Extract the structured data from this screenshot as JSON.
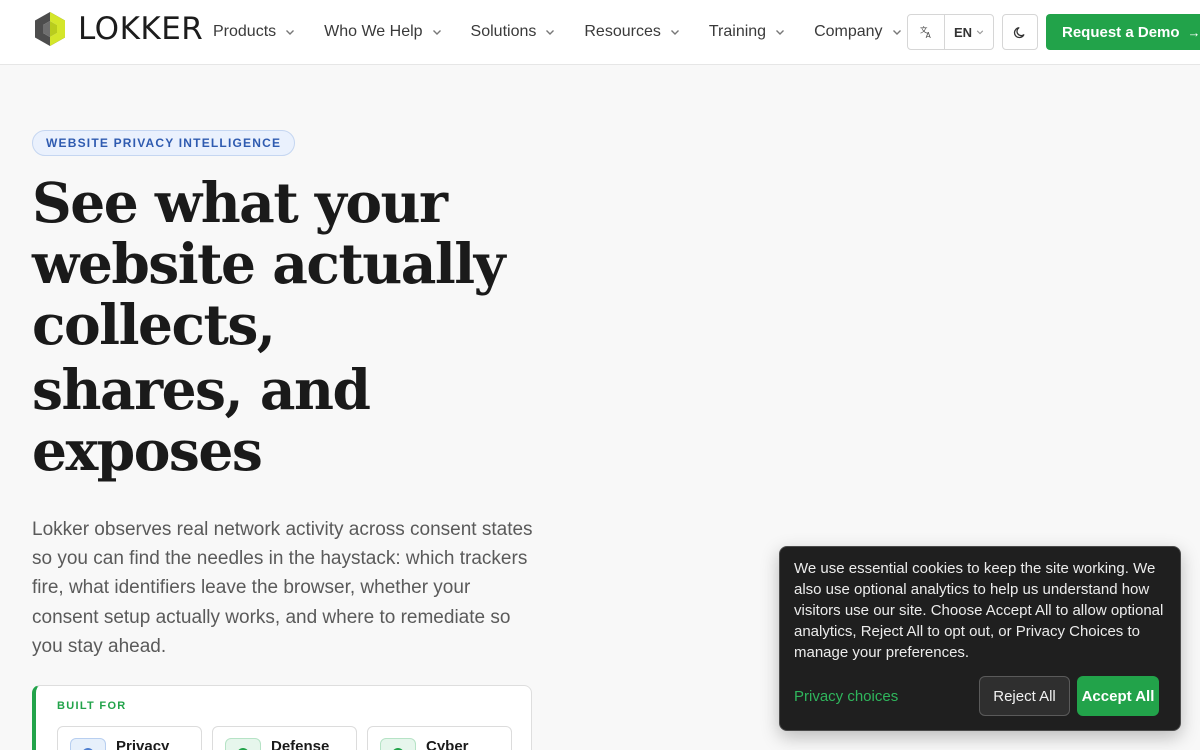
{
  "header": {
    "logo_text": "LOKKER",
    "nav": [
      {
        "label": "Products"
      },
      {
        "label": "Who We Help"
      },
      {
        "label": "Solutions"
      },
      {
        "label": "Resources"
      },
      {
        "label": "Training"
      },
      {
        "label": "Company"
      }
    ],
    "language_icon": "translate-icon",
    "language_value": "EN",
    "theme_icon": "moon-icon",
    "demo_label": "Request a Demo",
    "demo_arrow": "→"
  },
  "hero": {
    "eyebrow": "WEBSITE PRIVACY INTELLIGENCE",
    "headline_lines": [
      "See what your",
      "website actually",
      "collects,",
      "shares, and",
      "exposes"
    ],
    "lede": "Lokker observes real network activity across consent states so you can find the needles in the haystack: which trackers fire, what identifiers leave the browser, whether your consent setup actually works, and where to remediate so you stay ahead.",
    "built_for": {
      "label": "BUILT FOR",
      "chips": [
        {
          "label": "Privacy"
        },
        {
          "label": "Defense"
        },
        {
          "label": "Cyber"
        }
      ]
    }
  },
  "cookie_banner": {
    "text": "We use essential cookies to keep the site working. We also use optional analytics to help us understand how visitors use our site. Choose Accept All to allow optional analytics, Reject All to opt out, or Privacy Choices to manage your preferences.",
    "privacy_link": "Privacy choices",
    "reject_label": "Reject All",
    "accept_label": "Accept All"
  },
  "colors": {
    "brand_green": "#22a34a",
    "eyebrow_blue": "#2f5bb0",
    "logo_yellow": "#d4e62a",
    "logo_gray": "#5a5a5a"
  }
}
